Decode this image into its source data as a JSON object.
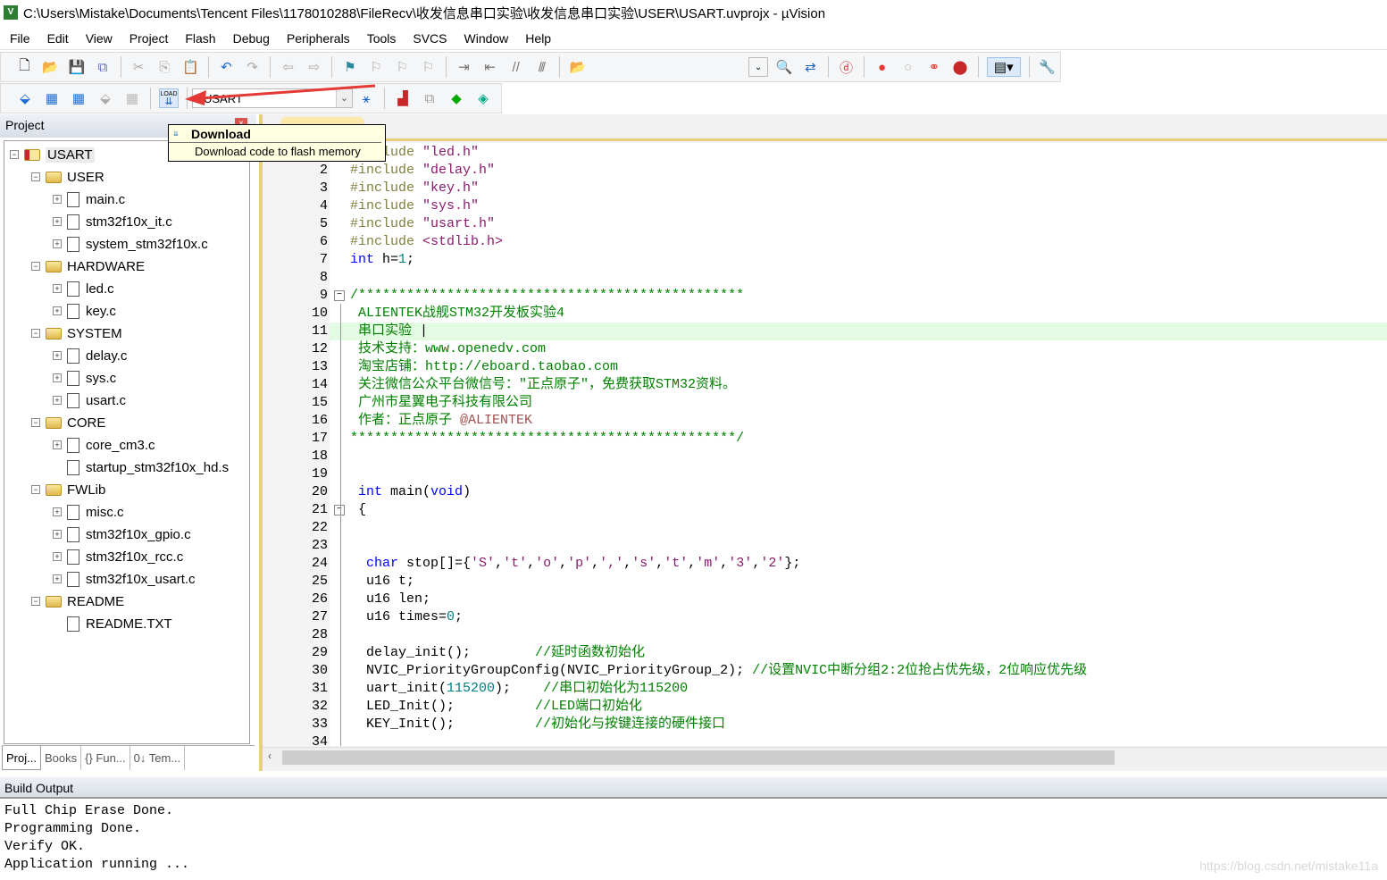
{
  "window": {
    "title": "C:\\Users\\Mistake\\Documents\\Tencent Files\\1178010288\\FileRecv\\收发信息串口实验\\收发信息串口实验\\USER\\USART.uvprojx - µVision",
    "app_icon": "V"
  },
  "menu": [
    "File",
    "Edit",
    "View",
    "Project",
    "Flash",
    "Debug",
    "Peripherals",
    "Tools",
    "SVCS",
    "Window",
    "Help"
  ],
  "toolbar2": {
    "target": "USART",
    "load_label": "LOAD"
  },
  "tooltip": {
    "title": "Download",
    "description": "Download code to flash memory"
  },
  "project": {
    "header": "Project",
    "tree": [
      {
        "label": "USART",
        "level": 0,
        "type": "root"
      },
      {
        "label": "USER",
        "level": 1,
        "type": "group"
      },
      {
        "label": "main.c",
        "level": 2,
        "type": "file"
      },
      {
        "label": "stm32f10x_it.c",
        "level": 2,
        "type": "file"
      },
      {
        "label": "system_stm32f10x.c",
        "level": 2,
        "type": "file"
      },
      {
        "label": "HARDWARE",
        "level": 1,
        "type": "group"
      },
      {
        "label": "led.c",
        "level": 2,
        "type": "file"
      },
      {
        "label": "key.c",
        "level": 2,
        "type": "file"
      },
      {
        "label": "SYSTEM",
        "level": 1,
        "type": "group"
      },
      {
        "label": "delay.c",
        "level": 2,
        "type": "file"
      },
      {
        "label": "sys.c",
        "level": 2,
        "type": "file"
      },
      {
        "label": "usart.c",
        "level": 2,
        "type": "file"
      },
      {
        "label": "CORE",
        "level": 1,
        "type": "group"
      },
      {
        "label": "core_cm3.c",
        "level": 2,
        "type": "file"
      },
      {
        "label": "startup_stm32f10x_hd.s",
        "level": 2,
        "type": "file",
        "noexpand": true
      },
      {
        "label": "FWLib",
        "level": 1,
        "type": "group"
      },
      {
        "label": "misc.c",
        "level": 2,
        "type": "file"
      },
      {
        "label": "stm32f10x_gpio.c",
        "level": 2,
        "type": "file"
      },
      {
        "label": "stm32f10x_rcc.c",
        "level": 2,
        "type": "file"
      },
      {
        "label": "stm32f10x_usart.c",
        "level": 2,
        "type": "file"
      },
      {
        "label": "README",
        "level": 1,
        "type": "group"
      },
      {
        "label": "README.TXT",
        "level": 2,
        "type": "file",
        "noexpand": true
      }
    ],
    "tabs": [
      "Proj...",
      "Books",
      "{} Fun...",
      "0↓ Tem..."
    ]
  },
  "editor": {
    "lines": [
      [
        [
          "#include ",
          "pp"
        ],
        [
          "\"led.h\"",
          "st"
        ]
      ],
      [
        [
          "#include ",
          "pp"
        ],
        [
          "\"delay.h\"",
          "st"
        ]
      ],
      [
        [
          "#include ",
          "pp"
        ],
        [
          "\"key.h\"",
          "st"
        ]
      ],
      [
        [
          "#include ",
          "pp"
        ],
        [
          "\"sys.h\"",
          "st"
        ]
      ],
      [
        [
          "#include ",
          "pp"
        ],
        [
          "\"usart.h\"",
          "st"
        ]
      ],
      [
        [
          "#include ",
          "pp"
        ],
        [
          "<stdlib.h>",
          "st"
        ]
      ],
      [
        [
          "int",
          "kw"
        ],
        [
          " h=",
          "pl"
        ],
        [
          "1",
          "nm"
        ],
        [
          ";",
          "pl"
        ]
      ],
      [],
      [
        [
          "/************************************************",
          "cm"
        ]
      ],
      [
        [
          " ALIENTEK战舰STM32开发板实验4",
          "cm"
        ]
      ],
      [
        [
          " 串口实验 ",
          "cm"
        ],
        [
          "|",
          "pl"
        ]
      ],
      [
        [
          " 技术支持：www.openedv.com",
          "cm"
        ]
      ],
      [
        [
          " 淘宝店铺：http://eboard.taobao.com",
          "cm"
        ]
      ],
      [
        [
          " 关注微信公众平台微信号：\"正点原子\"，免费获取STM32资料。",
          "cm"
        ]
      ],
      [
        [
          " 广州市星翼电子科技有限公司",
          "cm"
        ]
      ],
      [
        [
          " 作者：正点原子 ",
          "cm"
        ],
        [
          "@ALIENTEK",
          "at"
        ]
      ],
      [
        [
          "************************************************/",
          "cm"
        ]
      ],
      [],
      [],
      [
        [
          " ",
          "pl"
        ],
        [
          "int",
          "kw"
        ],
        [
          " main(",
          "pl"
        ],
        [
          "void",
          "kw"
        ],
        [
          ")",
          "pl"
        ]
      ],
      [
        [
          " {",
          "pl"
        ]
      ],
      [],
      [],
      [
        [
          "  ",
          "pl"
        ],
        [
          "char",
          "kw"
        ],
        [
          " stop[]={",
          "pl"
        ],
        [
          "'S'",
          "st"
        ],
        [
          ",",
          "pl"
        ],
        [
          "'t'",
          "st"
        ],
        [
          ",",
          "pl"
        ],
        [
          "'o'",
          "st"
        ],
        [
          ",",
          "pl"
        ],
        [
          "'p'",
          "st"
        ],
        [
          ",",
          "pl"
        ],
        [
          "','",
          "st"
        ],
        [
          ",",
          "pl"
        ],
        [
          "'s'",
          "st"
        ],
        [
          ",",
          "pl"
        ],
        [
          "'t'",
          "st"
        ],
        [
          ",",
          "pl"
        ],
        [
          "'m'",
          "st"
        ],
        [
          ",",
          "pl"
        ],
        [
          "'3'",
          "st"
        ],
        [
          ",",
          "pl"
        ],
        [
          "'2'",
          "st"
        ],
        [
          "};",
          "pl"
        ]
      ],
      [
        [
          "  u16 t;",
          "pl"
        ]
      ],
      [
        [
          "  u16 len;",
          "pl"
        ]
      ],
      [
        [
          "  u16 times=",
          "pl"
        ],
        [
          "0",
          "nm"
        ],
        [
          ";",
          "pl"
        ]
      ],
      [],
      [
        [
          "  delay_init();        ",
          "pl"
        ],
        [
          "//延时函数初始化",
          "cm"
        ]
      ],
      [
        [
          "  NVIC_PriorityGroupConfig(NVIC_PriorityGroup_2); ",
          "pl"
        ],
        [
          "//设置NVIC中断分组2:2位抢占优先级，2位响应优先级",
          "cm"
        ]
      ],
      [
        [
          "  uart_init(",
          "pl"
        ],
        [
          "115200",
          "nm"
        ],
        [
          ");    ",
          "pl"
        ],
        [
          "//串口初始化为115200",
          "cm"
        ]
      ],
      [
        [
          "  LED_Init();          ",
          "pl"
        ],
        [
          "//LED端口初始化",
          "cm"
        ]
      ],
      [
        [
          "  KEY_Init();          ",
          "pl"
        ],
        [
          "//初始化与按键连接的硬件接口",
          "cm"
        ]
      ],
      []
    ],
    "fold_lines": [
      9,
      21
    ],
    "highlight_line": 11
  },
  "build": {
    "header": "Build Output",
    "lines": [
      "Full Chip Erase Done.",
      "Programming Done.",
      "Verify OK.",
      "Application running ..."
    ]
  },
  "watermark": "https://blog.csdn.net/mistake11a",
  "colors": {
    "keyword": "#0000ff",
    "comment": "#008000",
    "highlight": "#e2fbe2",
    "arrow": "#e53935"
  }
}
